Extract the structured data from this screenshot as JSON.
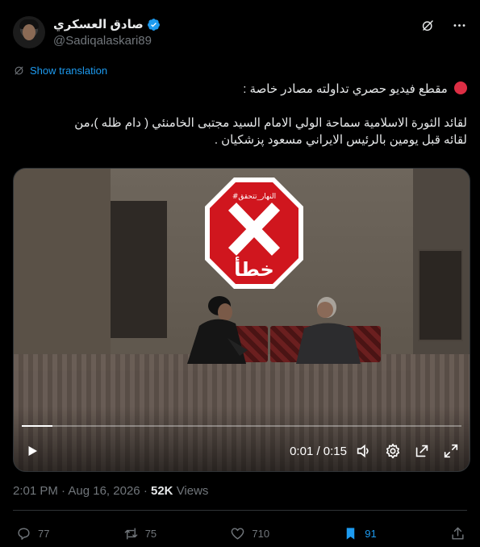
{
  "author": {
    "name": "صادق العسكري",
    "handle": "@Sadiqalaskari89"
  },
  "translate": {
    "label": "Show translation"
  },
  "tweet": {
    "line1": "مقطع فيديو حصري تداولته مصادر خاصة :",
    "line2": "لقائد الثورة الاسلامية سماحة الولي الامام السيد مجتبى الخامنئي ( دام ظله )،من",
    "line3": "لقائه قبل يومين بالرئيس الايراني مسعود پزشکيان ."
  },
  "stamp": {
    "tag": "#النهار_تتحقق",
    "verdict": "خطأ",
    "color": "#d0161e"
  },
  "video": {
    "time": "0:01 / 0:15",
    "progress": 0.07
  },
  "meta": {
    "time": "2:01 PM",
    "date": "Aug 16, 2026",
    "views": "52K",
    "views_label": "Views"
  },
  "actions": {
    "replies": "77",
    "reposts": "75",
    "likes": "710",
    "bookmarks": "91"
  },
  "colors": {
    "accent": "#1d9bf0",
    "muted": "#71767b"
  }
}
